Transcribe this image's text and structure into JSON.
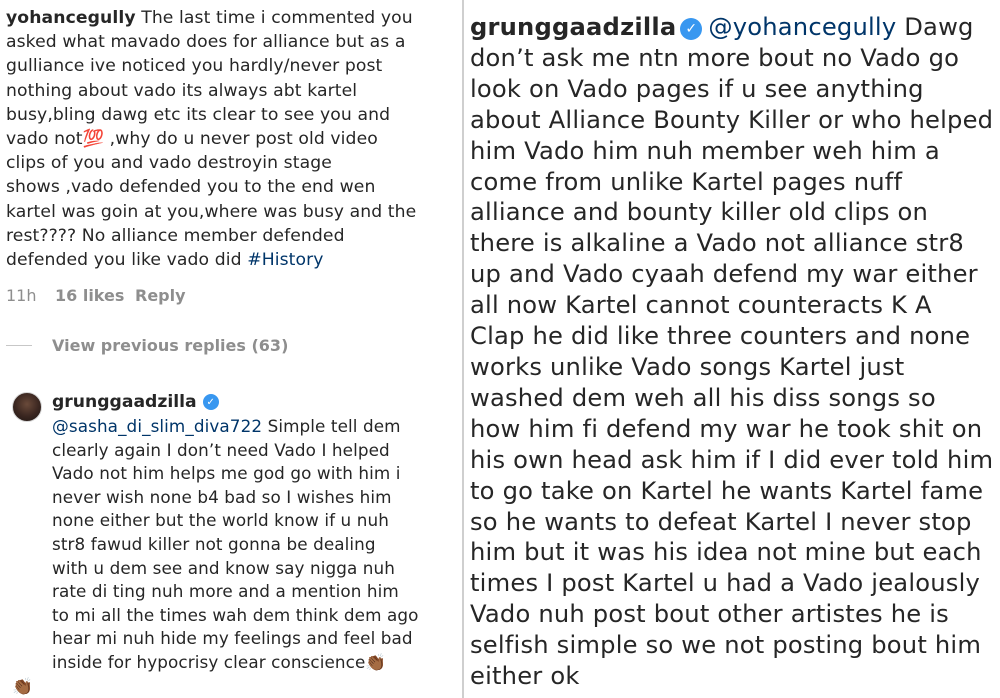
{
  "top_comment": {
    "username": "yohancegully",
    "lines": [
      " The last time i commented you",
      "asked what mavado does for alliance but as a",
      "gulliance ive noticed you hardly/never post",
      "nothing about vado its always abt kartel",
      "busy,bling dawg etc its clear to see you and",
      "vado not",
      " ,why do u never post old video",
      "clips of you and vado destroyin stage",
      "shows ,vado defended you to the end wen",
      "kartel was goin at you,where was busy and the",
      "rest???? No alliance  member defended",
      "defended you like vado did "
    ],
    "emoji_100": "💯",
    "hashtag": "#History",
    "time": "11h",
    "likes": "16 likes",
    "reply_label": "Reply"
  },
  "view_replies": "View previous replies (63)",
  "reply": {
    "username": "grunggaadzilla",
    "verified_icon": "✓",
    "mention": "@sasha_di_slim_diva722",
    "first_line_rest": " Simple tell dem",
    "lines": [
      "clearly again I don’t need Vado I helped",
      "Vado not him helps me god go with him i",
      "never wish none b4 bad so I wishes him",
      "none either but the world know if u nuh",
      "str8 fawud killer not gonna be dealing",
      "with u dem see and know say nigga nuh",
      "rate di ting nuh more and a mention him",
      "to mi all the times wah dem think dem ago",
      "hear mi nuh hide my feelings and feel bad",
      "inside for hypocrisy clear conscience"
    ],
    "clap_emoji": "👏🏾"
  },
  "right_comment": {
    "username": "grunggaadzilla",
    "verified_icon": "✓",
    "mention": "@yohancegully",
    "first_line_rest": " Dawg",
    "lines": [
      "don’t ask me ntn more bout no Vado go",
      "look on Vado pages if u see anything",
      "about Alliance Bounty Killer or who helped",
      "him Vado him nuh  member weh him a",
      "come from unlike Kartel pages nuff",
      "alliance and bounty killer old clips on",
      "there is alkaline a Vado not alliance str8",
      "up and Vado cyaah defend my war either",
      "all now Kartel cannot counteracts K A",
      "Clap he did like three counters and none",
      "works unlike Vado songs Kartel just",
      "washed dem weh all his diss songs so",
      "how him fi defend my war he took shit on",
      "his own head ask him if I did ever told him",
      "to go take on Kartel he wants Kartel fame",
      "so he wants to defeat Kartel I never stop",
      "him but it was his idea not mine but each",
      "times I post Kartel u had a Vado jealously",
      "Vado nuh post bout other artistes he is",
      "selfish simple so we not posting bout him",
      "either ok"
    ]
  },
  "colors": {
    "text": "#262626",
    "muted": "#8e8e8e",
    "link": "#003569",
    "verified": "#3897f0"
  }
}
